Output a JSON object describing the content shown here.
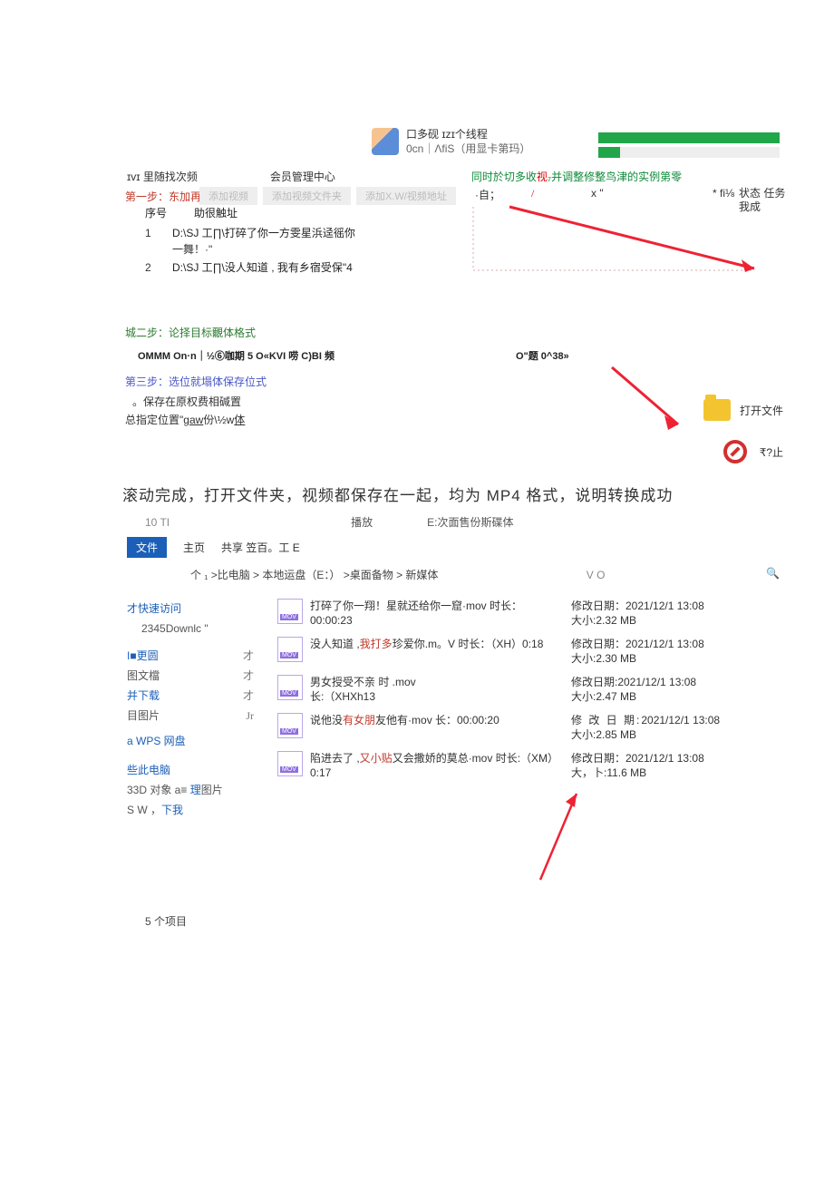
{
  "header": {
    "title": "口多砚 ɪzɪ个线程",
    "sub": "0cn｜ΛfiS（用显卡第玛）",
    "find_label": "ɪvɪ 里随找次频",
    "member_center": "会员管理中心",
    "green_left": "同时於切多收",
    "green_hl": "视",
    "green_right": "₇并调整修整鸟津的实例第零"
  },
  "step1": {
    "title": "第一步：东加再",
    "btn1": "添加视频",
    "btn2": "添加视频文件夹",
    "btn3": "添加X.W/视频地址",
    "col_no": "序号",
    "col_addr": "助很触址",
    "row1_no": "1",
    "row1_path": "D:\\SJ 工∏\\打碎了你一方雯星浜迳徭你",
    "row1_path2": "一舞！·\"",
    "row2_no": "2",
    "row2_path": "D:\\SJ 工∏\\没人知道 , 我有乡宿受保\"4",
    "right_zi": "·自；",
    "right_x": "x \"",
    "right_fi": "* fi⅛",
    "right_status": "状态 任务我成"
  },
  "step2": {
    "title": "城二步：论择目标覼体格式",
    "fmt1": "OMMM On·n｜½⑥咖期 5 O«KVI 唠 C)BI 频",
    "fmt2": "O\"题 0^38»"
  },
  "step3": {
    "title": "第三步：选位就塌体保存位式",
    "line1": "。保存在原权费相碱置",
    "line2_a": "总指定位置\"",
    "line2_b": "gaw",
    "line2_c": "份\\½w",
    "line2_d": "体",
    "open_label": "打开文件",
    "stop_label": "₹?止"
  },
  "caption": "滚动完成，打开文件夹，视频都保存在一起，均为 MP4 格式，说明转换成功",
  "explorer": {
    "ten": "10 TI",
    "play": "播放",
    "loc": "E:次面售份斯碟体",
    "tab_file": "文件",
    "tab_home": "主页",
    "tab_share": "共享 笠百。工 E",
    "path": "个 ₁ >比电脑 > 本地运盘（E：） >桌面备物 > 新媒体",
    "vo": "V O",
    "nav": {
      "quick": "才快速访问",
      "dl": "2345Downlc  \"",
      "more": "I■更圆",
      "docs": "图文檔",
      "down": "并下载",
      "pics": "目图片",
      "wps": "a WPS 网盘",
      "pc": "些此电脑",
      "obj_a": "33D 对象 a≡",
      "obj_b": "理",
      "obj_c": "图片",
      "sw_a": "S W ，",
      "sw_b": "下我",
      "pin1": "才",
      "pin2": "才",
      "pin3": "才",
      "pin4": "Jr"
    },
    "files": [
      {
        "name_a": "打碎了你一翔！星就还给你一窟·mov 时长：",
        "name_hl": "",
        "name_b": "00:00:23",
        "date": "修改日期：2021/12/1 13:08",
        "date_lbl": "",
        "size": "大小:2.32 MB"
      },
      {
        "name_a": "没人知道 ,",
        "name_hl": "我打多",
        "name_b": "珍爱你.m。V 时长：（XH）0:18",
        "date": "修改日期：2021/12/1 13:08",
        "date_lbl": "",
        "size": "大小:2.30 MB"
      },
      {
        "name_a": "男女授受不亲 时  .mov",
        "name_hl": "",
        "name_b": "长:（XHXh13",
        "date": "修改日期:2021/12/1 13:08",
        "date_lbl": "",
        "size": "大小:2.47 MB"
      },
      {
        "name_a": "说他没",
        "name_hl": "有女朋",
        "name_b": "友他有·mov 长：00:00:20",
        "date": "2021/12/1 13:08",
        "date_lbl": "修 改 日 期:",
        "size": "大小:2.85 MB"
      },
      {
        "name_a": "陷进去了 ,",
        "name_hl": "又小贴",
        "name_b": "又会撒娇的莫总·mov 时长:（XM）0:17",
        "date": "修改日期：2021/12/1 13:08",
        "date_lbl": "",
        "size": "大，卜:11.6 MB"
      }
    ],
    "count": "5 个项目"
  }
}
